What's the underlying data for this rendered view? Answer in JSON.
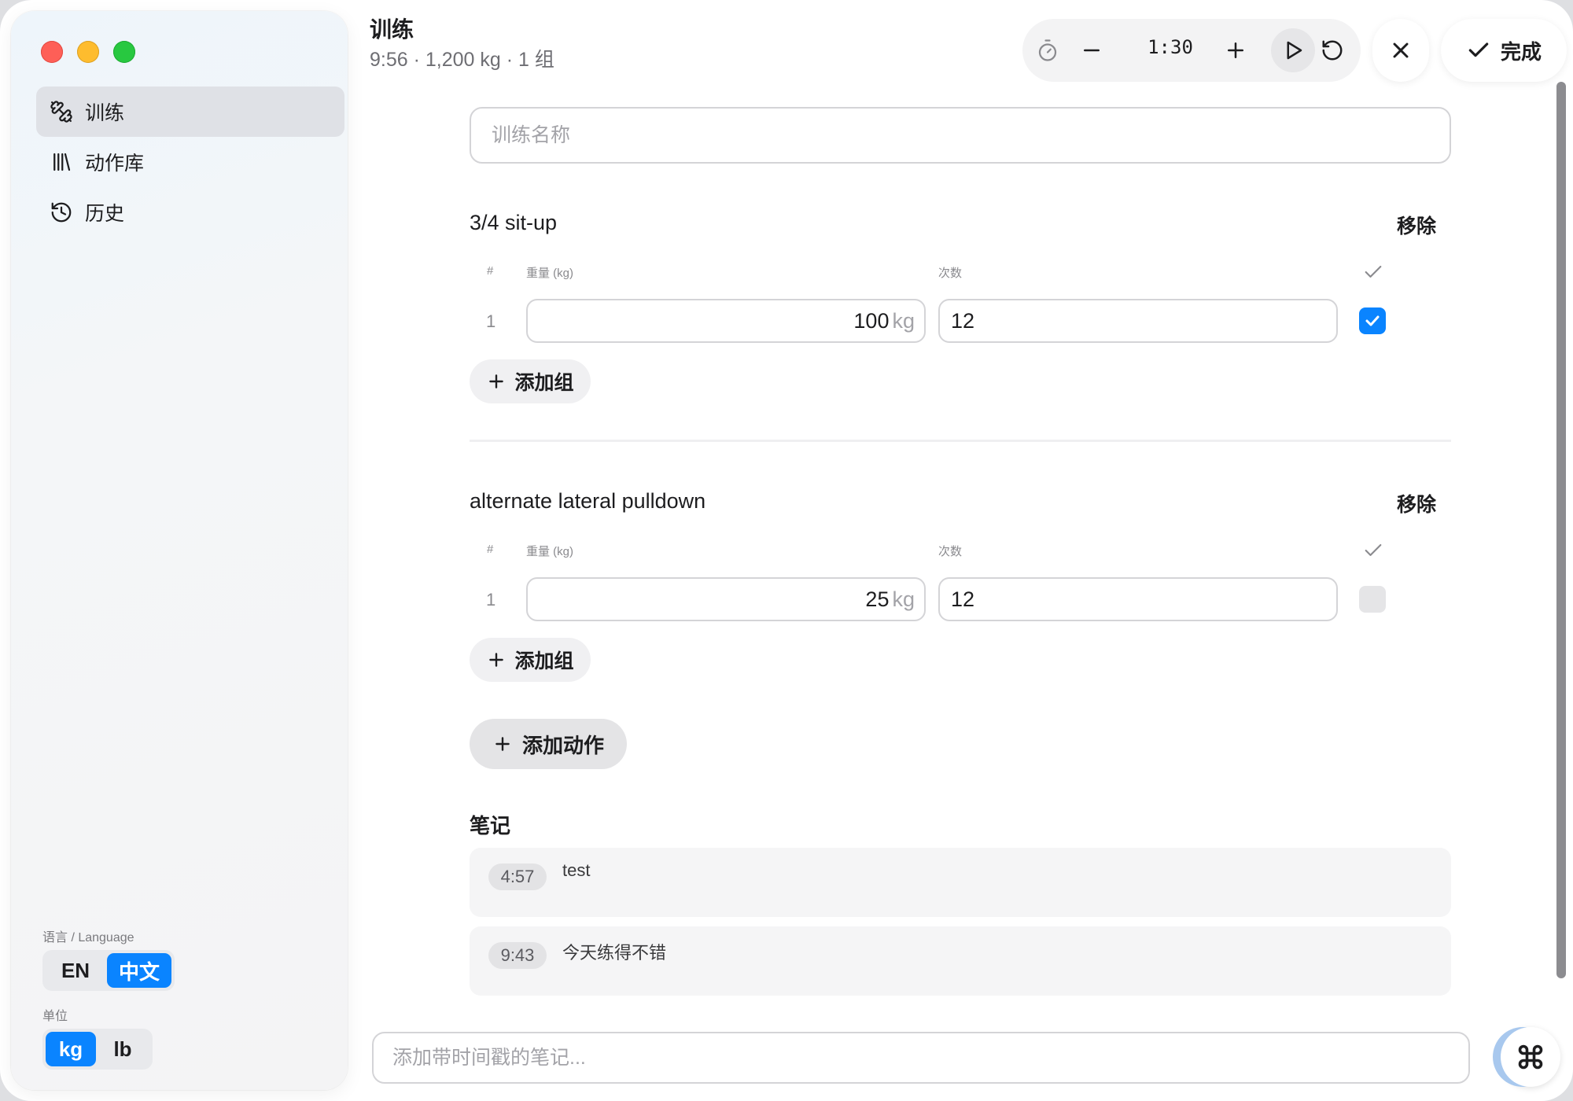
{
  "sidebar": {
    "items": [
      {
        "label": "训练",
        "icon": "dumbbell-icon"
      },
      {
        "label": "动作库",
        "icon": "library-icon"
      },
      {
        "label": "历史",
        "icon": "history-icon"
      }
    ],
    "language_caption": "语言 / Language",
    "language_options": [
      "EN",
      "中文"
    ],
    "language_selected": "中文",
    "unit_caption": "单位",
    "unit_options": [
      "kg",
      "lb"
    ],
    "unit_selected": "kg"
  },
  "header": {
    "title": "训练",
    "subtitle": "9:56 · 1,200 kg · 1 组",
    "timer": "1:30",
    "done_label": "完成"
  },
  "workout": {
    "name_placeholder": "训练名称",
    "columns": {
      "index": "#",
      "weight": "重量 (kg)",
      "reps": "次数"
    },
    "remove_label": "移除",
    "add_set_label": "添加组",
    "exercises": [
      {
        "name": "3/4 sit-up",
        "sets": [
          {
            "index": "1",
            "weight": "100",
            "unit": "kg",
            "reps": "12",
            "completed": true
          }
        ]
      },
      {
        "name": "alternate lateral pulldown",
        "sets": [
          {
            "index": "1",
            "weight": "25",
            "unit": "kg",
            "reps": "12",
            "completed": false
          }
        ]
      }
    ],
    "add_exercise_label": "添加动作"
  },
  "notes": {
    "heading": "笔记",
    "items": [
      {
        "timestamp": "4:57",
        "text": "test"
      },
      {
        "timestamp": "9:43",
        "text": "今天练得不错"
      }
    ],
    "input_placeholder": "添加带时间戳的笔记..."
  },
  "colors": {
    "accent": "#0a84ff",
    "tl_red": "#fe5f57",
    "tl_yellow": "#febc2e",
    "tl_green": "#28c840"
  }
}
